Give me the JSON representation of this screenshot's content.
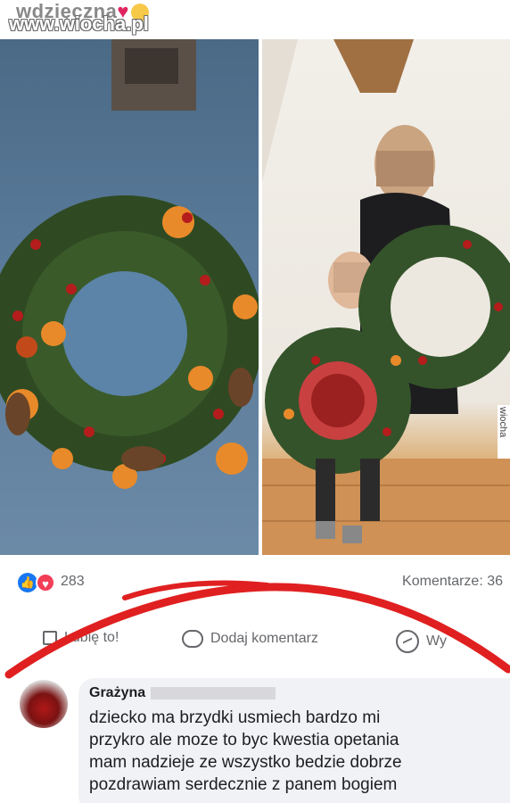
{
  "post": {
    "caption_partial": "wdzięczna",
    "watermark": "www.wiocha.pl",
    "side_label": "wiocha"
  },
  "reactions": {
    "count": "283",
    "comments_label": "Komentarze: 36"
  },
  "actions": {
    "like": "Lubię to!",
    "comment": "Dodaj komentarz",
    "share": "Wy"
  },
  "comment": {
    "author": "Grażyna",
    "lines": [
      "dziecko ma brzydki usmiech bardzo mi",
      "przykro ale moze to byc kwestia opetania",
      "mam nadzieje ze wszystko bedzie dobrze",
      "pozdrawiam serdecznie z panem bogiem"
    ]
  },
  "colors": {
    "like_blue": "#1877f2",
    "love_red": "#f33e58",
    "annotation_red": "#e02020"
  }
}
